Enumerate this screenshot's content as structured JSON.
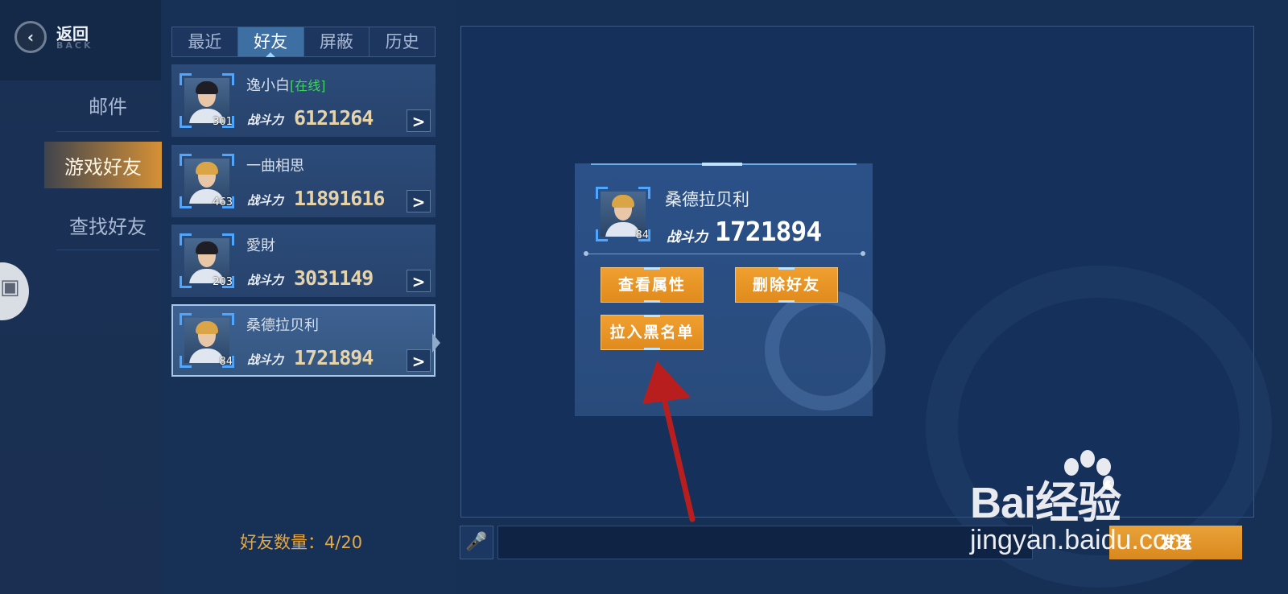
{
  "back": {
    "label": "返回",
    "sub": "BACK"
  },
  "menu": {
    "items": [
      {
        "label": "邮件"
      },
      {
        "label": "游戏好友"
      },
      {
        "label": "查找好友"
      }
    ],
    "active_index": 1
  },
  "tabs": [
    {
      "label": "最近"
    },
    {
      "label": "好友"
    },
    {
      "label": "屏蔽"
    },
    {
      "label": "历史"
    }
  ],
  "active_tab": 1,
  "friends": [
    {
      "name": "逸小白",
      "status": "[在线]",
      "level": "301",
      "power_label": "战斗力",
      "power": "6121264",
      "hair": "dark",
      "arrow": ">"
    },
    {
      "name": "一曲相思",
      "status": "",
      "level": "463",
      "power_label": "战斗力",
      "power": "11891616",
      "hair": "blond",
      "arrow": ">"
    },
    {
      "name": "愛財",
      "status": "",
      "level": "203",
      "power_label": "战斗力",
      "power": "3031149",
      "hair": "dark",
      "arrow": ">"
    },
    {
      "name": "桑德拉贝利",
      "status": "",
      "level": "84",
      "power_label": "战斗力",
      "power": "1721894",
      "hair": "blond",
      "arrow": ">"
    }
  ],
  "selected_friend": 3,
  "friend_count": "好友数量：4/20",
  "popup": {
    "name": "桑德拉贝利",
    "level": "84",
    "power_label": "战斗力",
    "power": "1721894",
    "buttons": {
      "view": "查看属性",
      "delete": "删除好友",
      "blacklist": "拉入黑名单"
    }
  },
  "chat": {
    "input_value": "",
    "send_label": "发送"
  },
  "watermark": {
    "logo": "Bai经验",
    "url": "jingyan.baidu.com"
  },
  "colors": {
    "accent_orange": "#e08a1c",
    "online_green": "#3ed45e",
    "annotation_red": "#b81e1e",
    "frame_blue": "#4ea6ff"
  }
}
